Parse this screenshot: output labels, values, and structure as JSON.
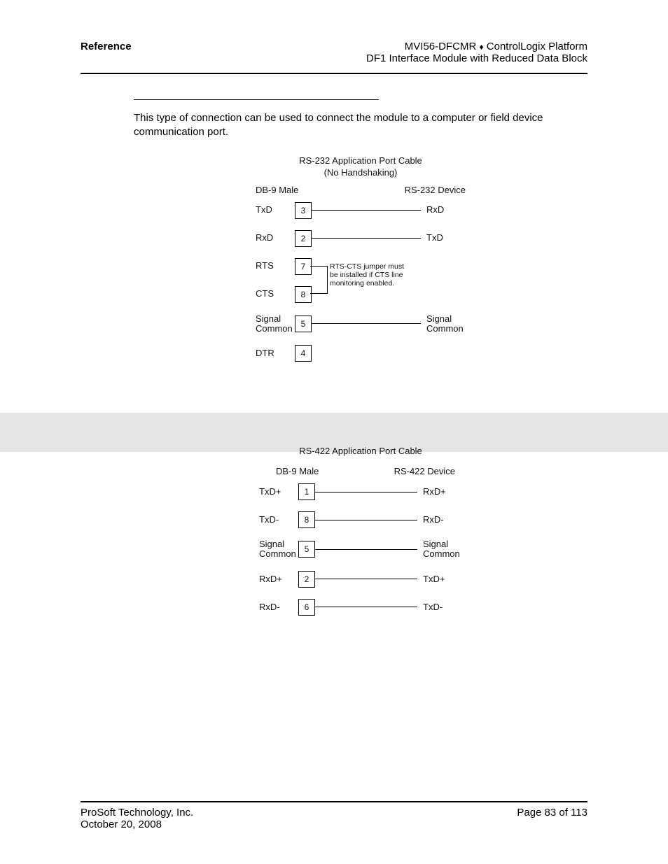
{
  "header": {
    "left": "Reference",
    "right_line1_a": "MVI56-DFCMR",
    "right_line1_b": "ControlLogix Platform",
    "right_line2": "DF1 Interface Module with Reduced Data Block"
  },
  "body": {
    "paragraph": "This type of connection can be used to connect the module to a computer or field device communication port."
  },
  "diagram1": {
    "title": "RS-232 Application Port Cable",
    "subtitle": "(No Handshaking)",
    "col_left": "DB-9 Male",
    "col_right": "RS-232 Device",
    "rows": {
      "r1": {
        "left": "TxD",
        "pin": "3",
        "right": "RxD"
      },
      "r2": {
        "left": "RxD",
        "pin": "2",
        "right": "TxD"
      },
      "r3": {
        "left": "RTS",
        "pin": "7",
        "right": ""
      },
      "r4": {
        "left": "CTS",
        "pin": "8",
        "right": ""
      },
      "r5a": {
        "left_a": "Signal",
        "left_b": "Common",
        "pin": "5",
        "right_a": "Signal",
        "right_b": "Common"
      },
      "r6": {
        "left": "DTR",
        "pin": "4",
        "right": ""
      }
    },
    "note_l1": "RTS-CTS jumper must",
    "note_l2": "be installed if CTS line",
    "note_l3": "monitoring enabled."
  },
  "diagram2": {
    "title": "RS-422 Application Port Cable",
    "col_left": "DB-9 Male",
    "col_right": "RS-422 Device",
    "rows": {
      "r1": {
        "left": "TxD+",
        "pin": "1",
        "right": "RxD+"
      },
      "r2": {
        "left": "TxD-",
        "pin": "8",
        "right": "RxD-"
      },
      "r3a": {
        "left_a": "Signal",
        "left_b": "Common",
        "pin": "5",
        "right_a": "Signal",
        "right_b": "Common"
      },
      "r4": {
        "left": "RxD+",
        "pin": "2",
        "right": "TxD+"
      },
      "r5": {
        "left": "RxD-",
        "pin": "6",
        "right": "TxD-"
      }
    }
  },
  "footer": {
    "left_l1": "ProSoft Technology, Inc.",
    "left_l2": "October 20, 2008",
    "right": "Page 83 of 113"
  }
}
